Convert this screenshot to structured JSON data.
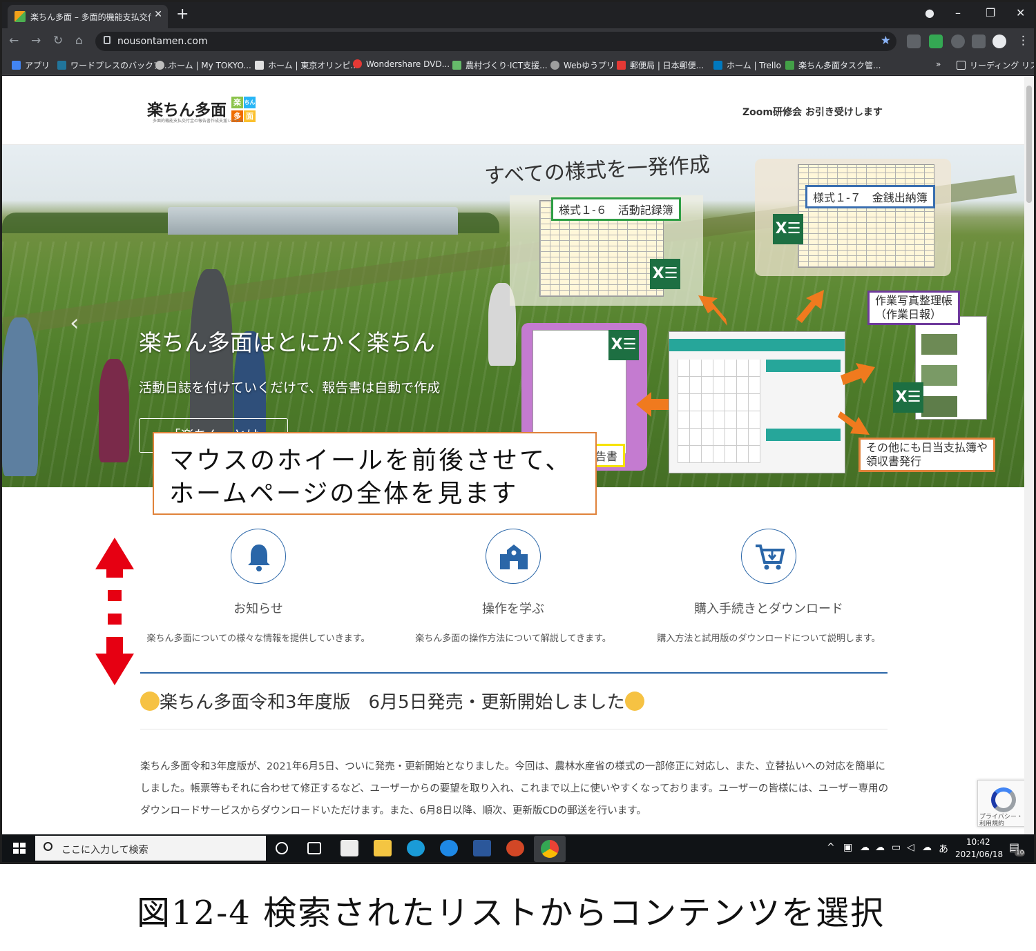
{
  "browser": {
    "tab_title": "楽ちん多面 – 多面的機能支払交付",
    "new_tab": "+",
    "url": "nousontamen.com",
    "win_min": "–",
    "win_max": "❐",
    "win_close": "✕"
  },
  "bookmarks": [
    "アプリ",
    "ワードプレスのバックア...",
    "ホーム | My TOKYO...",
    "ホーム | 東京オリンピ...",
    "Wondershare DVD...",
    "農村づくり·ICT支援...",
    "Webゆうプリ",
    "郵便局 | 日本郵便...",
    "ホーム | Trello",
    "楽ちん多面タスク管...",
    "»",
    "リーディング リスト"
  ],
  "site": {
    "logo": "楽ちん多面",
    "logo_tiles": [
      "楽",
      "ちん",
      "多",
      "面"
    ],
    "logo_sub": "多面的機能支払交付金の報告書作成支援システム",
    "header_link": "Zoom研修会 お引き受けします"
  },
  "hero": {
    "title": "楽ちん多面はとにかく楽ちん",
    "subtitle": "活動日誌を付けていくだけで、報告書は自動で作成",
    "button": "「楽ちん」とは",
    "headline": "すべての様式を一発作成",
    "label_16": "様式１-６　活動記録簿",
    "label_17": "様式１-７　金銭出納簿",
    "label_photo_1": "作業写真整理帳",
    "label_photo_2": "（作業日報）",
    "label_other_1": "その他にも日当支払簿や",
    "label_other_2": "領収書発行",
    "label_report": "告書",
    "xl_mark": "X☰"
  },
  "annotation": {
    "line1": "マウスのホイールを前後させて、",
    "line2": "ホームページの全体を見ます"
  },
  "features": [
    {
      "icon": "bell-icon",
      "title": "お知らせ",
      "desc": "楽ちん多面についての様々な情報を提供していきます。"
    },
    {
      "icon": "school-icon",
      "title": "操作を学ぶ",
      "desc": "楽ちん多面の操作方法について解説してきます。"
    },
    {
      "icon": "cart-download-icon",
      "title": "購入手続きとダウンロード",
      "desc": "購入方法と試用版のダウンロードについて説明します。"
    }
  ],
  "news": {
    "title": "楽ちん多面令和3年度版　6月5日発売・更新開始しました",
    "body": "楽ちん多面令和3年度版が、2021年6月5日、ついに発売・更新開始となりました。今回は、農林水産省の様式の一部修正に対応し、また、立替払いへの対応を簡単にしました。帳票等もそれに合わせて修正するなど、ユーザーからの要望を取り入れ、これまで以上に使いやすくなっております。ユーザーの皆様には、ユーザー専用のダウンロードサービスからダウンロードいただけます。また、6月8日以降、順次、更新版CDの郵送を行います。"
  },
  "recaptcha": {
    "line1": "プライバシー・",
    "line2": "利用規約"
  },
  "taskbar": {
    "search_placeholder": "ここに入力して検索",
    "time": "10:42",
    "date": "2021/06/18",
    "ime": "あ",
    "notif_count": "10"
  },
  "caption": "図12-4  検索されたリストからコンテンツを選択",
  "colors": {
    "accent_blue": "#2a66a8",
    "annotation_orange": "#e0823a",
    "arrow_red": "#e60012",
    "excel_green": "#1d6f42"
  }
}
